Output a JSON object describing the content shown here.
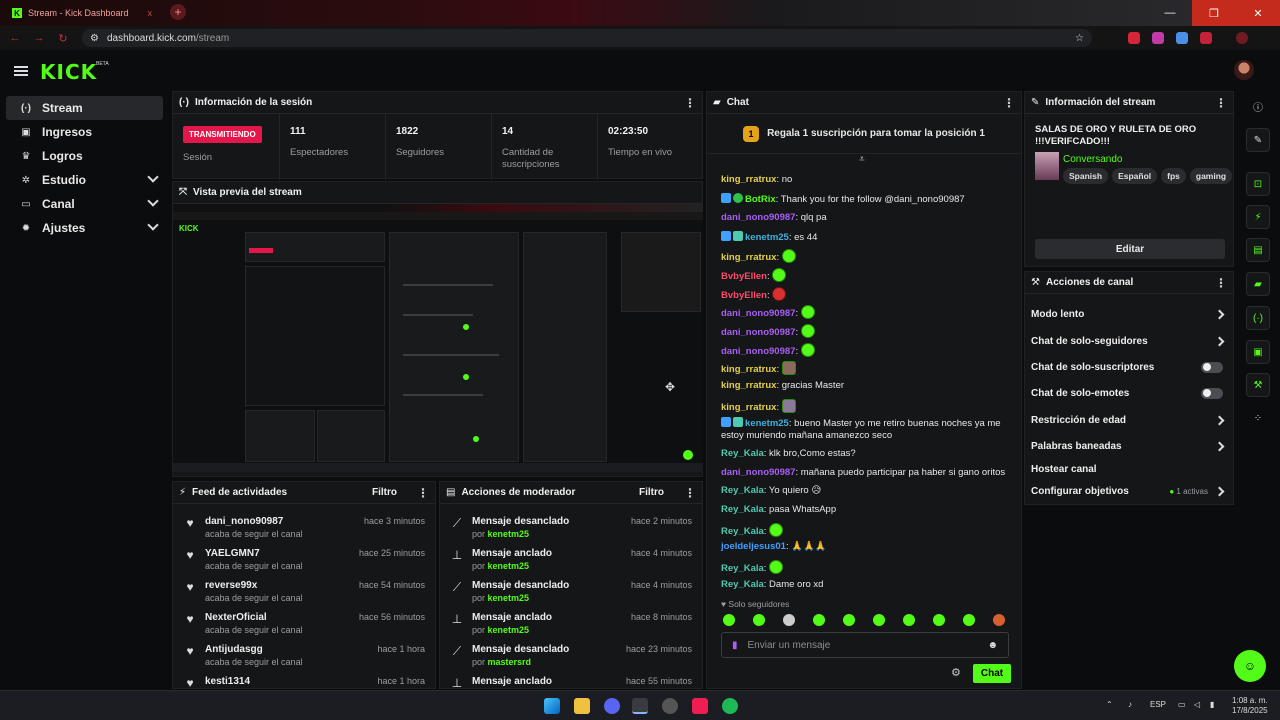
{
  "browser": {
    "tab_title": "Stream - Kick Dashboard",
    "tab_close": "x",
    "new_tab": "+",
    "url_host": "dashboard.kick.com",
    "url_path": "/stream",
    "minimize": "—",
    "maximize": "❐",
    "close": "✕"
  },
  "app": {
    "logo": "KICK",
    "beta": "BETA"
  },
  "sidebar": {
    "items": [
      {
        "label": "Stream",
        "icon": "broadcast-icon"
      },
      {
        "label": "Ingresos",
        "icon": "money-icon"
      },
      {
        "label": "Logros",
        "icon": "trophy-icon"
      },
      {
        "label": "Estudio",
        "icon": "studio-icon"
      },
      {
        "label": "Canal",
        "icon": "channel-icon"
      },
      {
        "label": "Ajustes",
        "icon": "gear-icon"
      }
    ]
  },
  "session": {
    "title": "Información de la sesión",
    "live_badge": "TRANSMITIENDO",
    "status_label": "Sesión",
    "stats": [
      {
        "value": "111",
        "label": "Espectadores"
      },
      {
        "value": "1822",
        "label": "Seguidores"
      },
      {
        "value": "14",
        "label": "Cantidad de suscripciones"
      },
      {
        "value": "02:23:50",
        "label": "Tiempo en vivo"
      }
    ]
  },
  "preview": {
    "title": "Vista previa del stream"
  },
  "feed": {
    "title": "Feed de actividades",
    "filter": "Filtro",
    "items": [
      {
        "name": "dani_nono90987",
        "sub": "acaba de seguir el canal",
        "time": "hace 3 minutos"
      },
      {
        "name": "YAELGMN7",
        "sub": "acaba de seguir el canal",
        "time": "hace 25 minutos"
      },
      {
        "name": "reverse99x",
        "sub": "acaba de seguir el canal",
        "time": "hace 54 minutos"
      },
      {
        "name": "NexterOficial",
        "sub": "acaba de seguir el canal",
        "time": "hace 56 minutos"
      },
      {
        "name": "Antijudasgg",
        "sub": "acaba de seguir el canal",
        "time": "hace 1 hora"
      },
      {
        "name": "kesti1314",
        "sub": "",
        "time": "hace 1 hora"
      }
    ]
  },
  "mod": {
    "title": "Acciones de moderador",
    "filter": "Filtro",
    "by": "por",
    "items": [
      {
        "action": "Mensaje desanclado",
        "by": "kenetm25",
        "time": "hace 2 minutos"
      },
      {
        "action": "Mensaje anclado",
        "by": "kenetm25",
        "time": "hace 4 minutos"
      },
      {
        "action": "Mensaje desanclado",
        "by": "kenetm25",
        "time": "hace 4 minutos"
      },
      {
        "action": "Mensaje anclado",
        "by": "kenetm25",
        "time": "hace 8 minutos"
      },
      {
        "action": "Mensaje desanclado",
        "by": "mastersrd",
        "time": "hace 23 minutos"
      },
      {
        "action": "Mensaje anclado",
        "by": "",
        "time": "hace 55 minutos"
      }
    ]
  },
  "chat": {
    "title": "Chat",
    "promo": "Regala 1 suscripción para tomar la posición 1",
    "promo_rank": "1",
    "messages": [
      {
        "user": "king_rratrux",
        "text": ": no"
      },
      {
        "user": "BotRix",
        "text": ": Thank you for the follow @dani_nono90987"
      },
      {
        "user": "dani_nono90987",
        "text": ": qlq pa"
      },
      {
        "user": "kenetm25",
        "text": ": es 44"
      },
      {
        "user": "king_rratrux",
        "text": ":"
      },
      {
        "user": "BvbyEllen",
        "text": ":"
      },
      {
        "user": "BvbyEllen",
        "text": ":"
      },
      {
        "user": "dani_nono90987",
        "text": ":"
      },
      {
        "user": "dani_nono90987",
        "text": ":"
      },
      {
        "user": "dani_nono90987",
        "text": ":"
      },
      {
        "user": "king_rratrux",
        "text": ":"
      },
      {
        "user": "king_rratrux",
        "text": ": gracias Master"
      },
      {
        "user": "king_rratrux",
        "text": ":"
      },
      {
        "user": "kenetm25",
        "text": ": bueno Master yo me retiro buenas noches ya me estoy muriendo mañana amanezco seco"
      },
      {
        "user": "Rey_Kala",
        "text": ": klk bro,Como estas?"
      },
      {
        "user": "dani_nono90987",
        "text": ": mañana puedo participar pa haber si gano oritos"
      },
      {
        "user": "Rey_Kala",
        "text": ": Yo quiero 😥"
      },
      {
        "user": "Rey_Kala",
        "text": ": pasa WhatsApp"
      },
      {
        "user": "Rey_Kala",
        "text": ":"
      },
      {
        "user": "joeldeljesus01",
        "text": ": 🙏🙏🙏"
      },
      {
        "user": "Rey_Kala",
        "text": ":"
      },
      {
        "user": "Rey_Kala",
        "text": ": Dame oro xd"
      }
    ],
    "followers_only": "♥ Solo seguidores",
    "input_placeholder": "Enviar un mensaje",
    "send": "Chat"
  },
  "stream_info": {
    "title": "Información del stream",
    "stream_title": "SALAS DE ORO Y RULETA DE ORO !!!VERIFCADO!!!",
    "category": "Conversando",
    "tags": [
      "Spanish",
      "Español",
      "fps",
      "gaming"
    ],
    "edit": "Editar"
  },
  "channel_actions": {
    "title": "Acciones de canal",
    "items": [
      {
        "label": "Modo lento",
        "control": "chevron"
      },
      {
        "label": "Chat de solo-seguidores",
        "control": "chevron"
      },
      {
        "label": "Chat de solo-suscriptores",
        "control": "toggle"
      },
      {
        "label": "Chat de solo-emotes",
        "control": "toggle"
      },
      {
        "label": "Restricción de edad",
        "control": "chevron"
      },
      {
        "label": "Palabras baneadas",
        "control": "chevron"
      },
      {
        "label": "Hostear canal",
        "control": "none"
      },
      {
        "label": "Configurar objetivos",
        "control": "chevron"
      }
    ],
    "goals_active": "1 activas"
  },
  "taskbar": {
    "lang": "ESP",
    "time": "1:08 a. m.",
    "date": "17/8/2025"
  },
  "colors": {
    "brand": "#53fc18",
    "live": "#e5174a",
    "panel": "#151617"
  }
}
